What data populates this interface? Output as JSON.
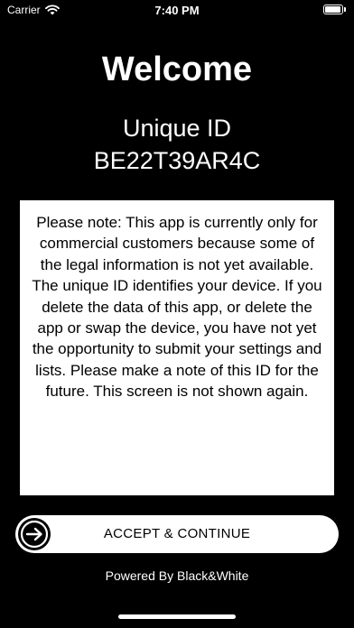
{
  "status_bar": {
    "carrier": "Carrier",
    "time": "7:40 PM",
    "battery_level": 1.0
  },
  "welcome": {
    "title": "Welcome",
    "id_label": "Unique ID",
    "id_value": "BE22T39AR4C"
  },
  "note": {
    "text": "Please note: This app is currently only for commercial customers because some of the legal information is not yet available. The unique ID identifies your device. If you delete the data of this app, or delete the app or swap the device, you have not yet the opportunity to submit your settings and lists. Please make a note of this ID for the future. This screen is not shown again."
  },
  "accept_button": {
    "label": "ACCEPT & CONTINUE",
    "icon": "arrow-right-circle-icon"
  },
  "footer": {
    "text": "Powered By Black&White"
  },
  "colors": {
    "background": "#000000",
    "foreground": "#ffffff",
    "box_text": "#000000"
  }
}
